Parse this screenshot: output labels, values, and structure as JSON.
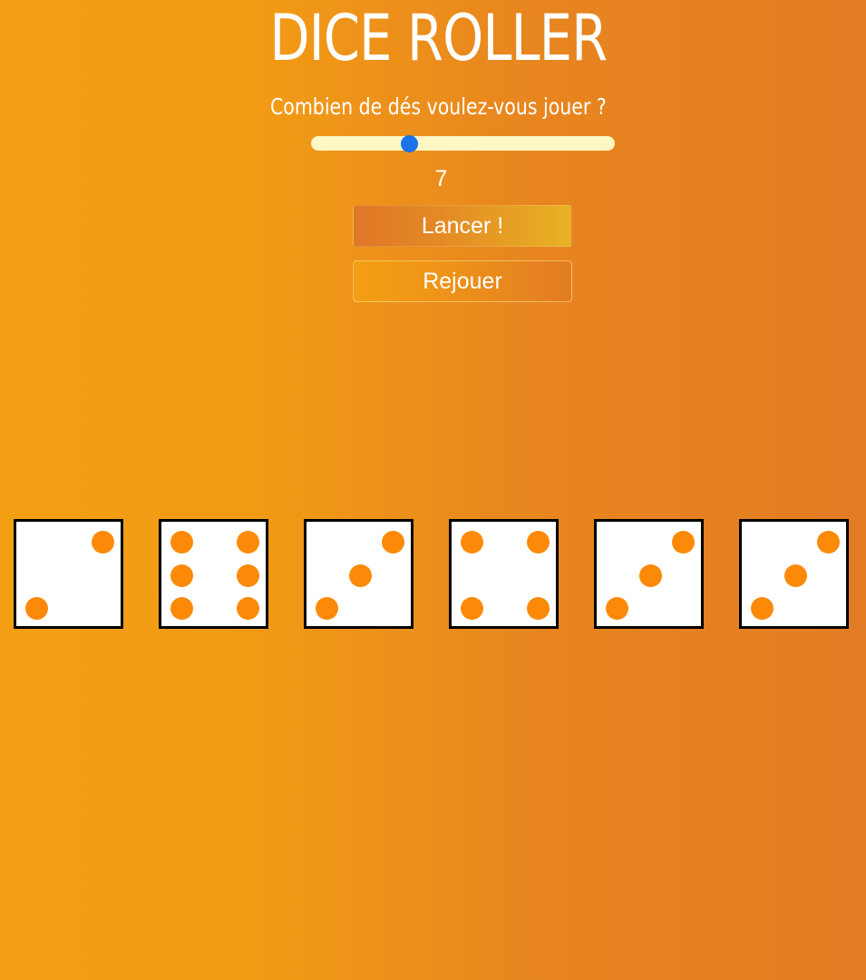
{
  "app": {
    "title": "DICE ROLLER"
  },
  "controls": {
    "question": "Combien de dés voulez-vous jouer ?",
    "slider_value": 7,
    "count_label": "7",
    "roll_label": "Lancer !",
    "replay_label": "Rejouer"
  },
  "colors": {
    "pip": "#fc8a08",
    "slider_thumb": "#1a73e8",
    "slider_track": "#fdf7c4"
  },
  "dice": [
    {
      "value": 2
    },
    {
      "value": 6
    },
    {
      "value": 3
    },
    {
      "value": 4
    },
    {
      "value": 3
    },
    {
      "value": 3
    }
  ]
}
